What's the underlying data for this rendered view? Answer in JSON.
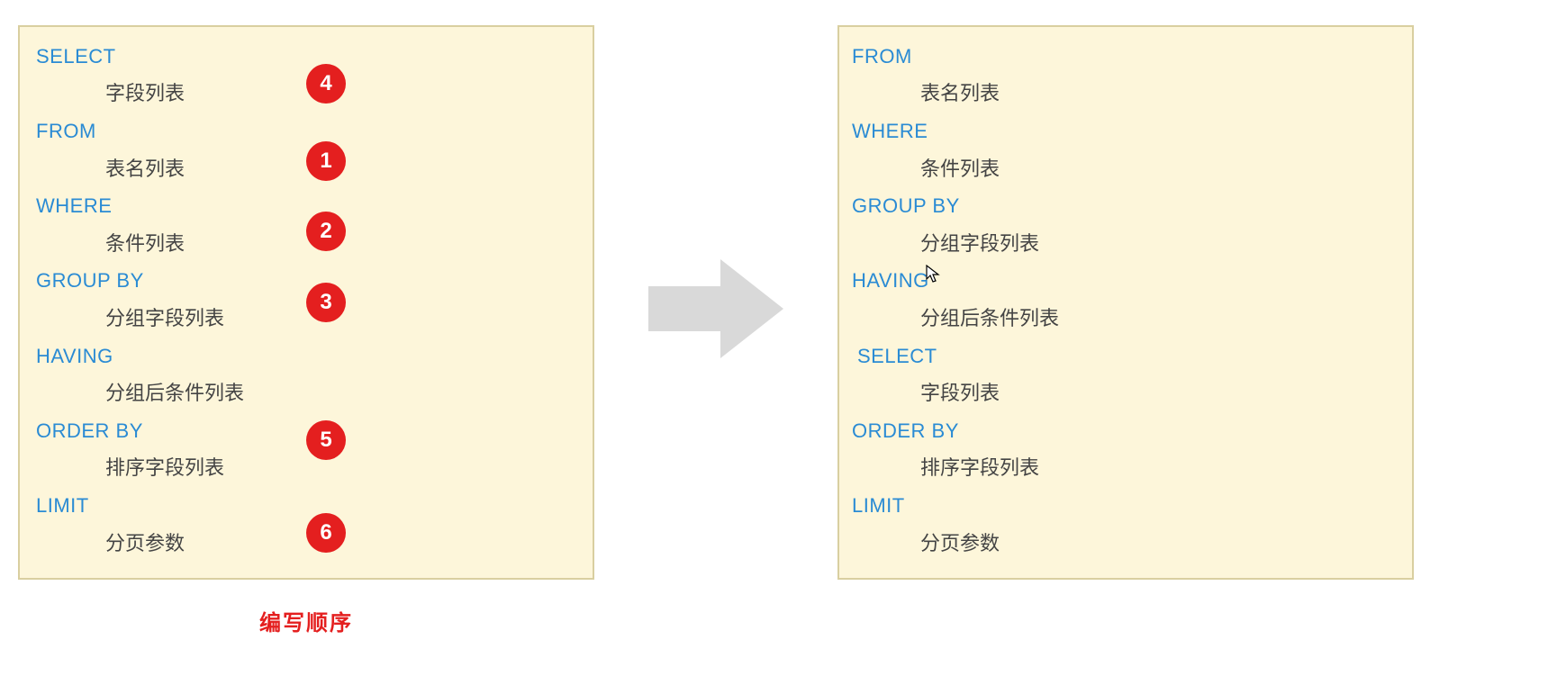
{
  "left": {
    "items": [
      {
        "keyword": "SELECT",
        "desc": "字段列表"
      },
      {
        "keyword": "FROM",
        "desc": "表名列表"
      },
      {
        "keyword": "WHERE",
        "desc": "条件列表"
      },
      {
        "keyword": "GROUP  BY",
        "desc": "分组字段列表"
      },
      {
        "keyword": "HAVING",
        "desc": "分组后条件列表"
      },
      {
        "keyword": "ORDER BY",
        "desc": "排序字段列表"
      },
      {
        "keyword": "LIMIT",
        "desc": "分页参数"
      }
    ],
    "badges": [
      {
        "n": "4"
      },
      {
        "n": "1"
      },
      {
        "n": "2"
      },
      {
        "n": "3"
      },
      {
        "n": "5"
      },
      {
        "n": "6"
      }
    ],
    "caption": "编写顺序"
  },
  "right": {
    "items": [
      {
        "keyword": "FROM",
        "desc": "表名列表"
      },
      {
        "keyword": "WHERE",
        "desc": "条件列表"
      },
      {
        "keyword": "GROUP  BY",
        "desc": "分组字段列表"
      },
      {
        "keyword": "HAVING",
        "desc": "分组后条件列表"
      },
      {
        "keyword": "SELECT",
        "desc": "字段列表",
        "shift": true
      },
      {
        "keyword": "ORDER BY",
        "desc": "排序字段列表"
      },
      {
        "keyword": "LIMIT",
        "desc": "分页参数"
      }
    ]
  }
}
